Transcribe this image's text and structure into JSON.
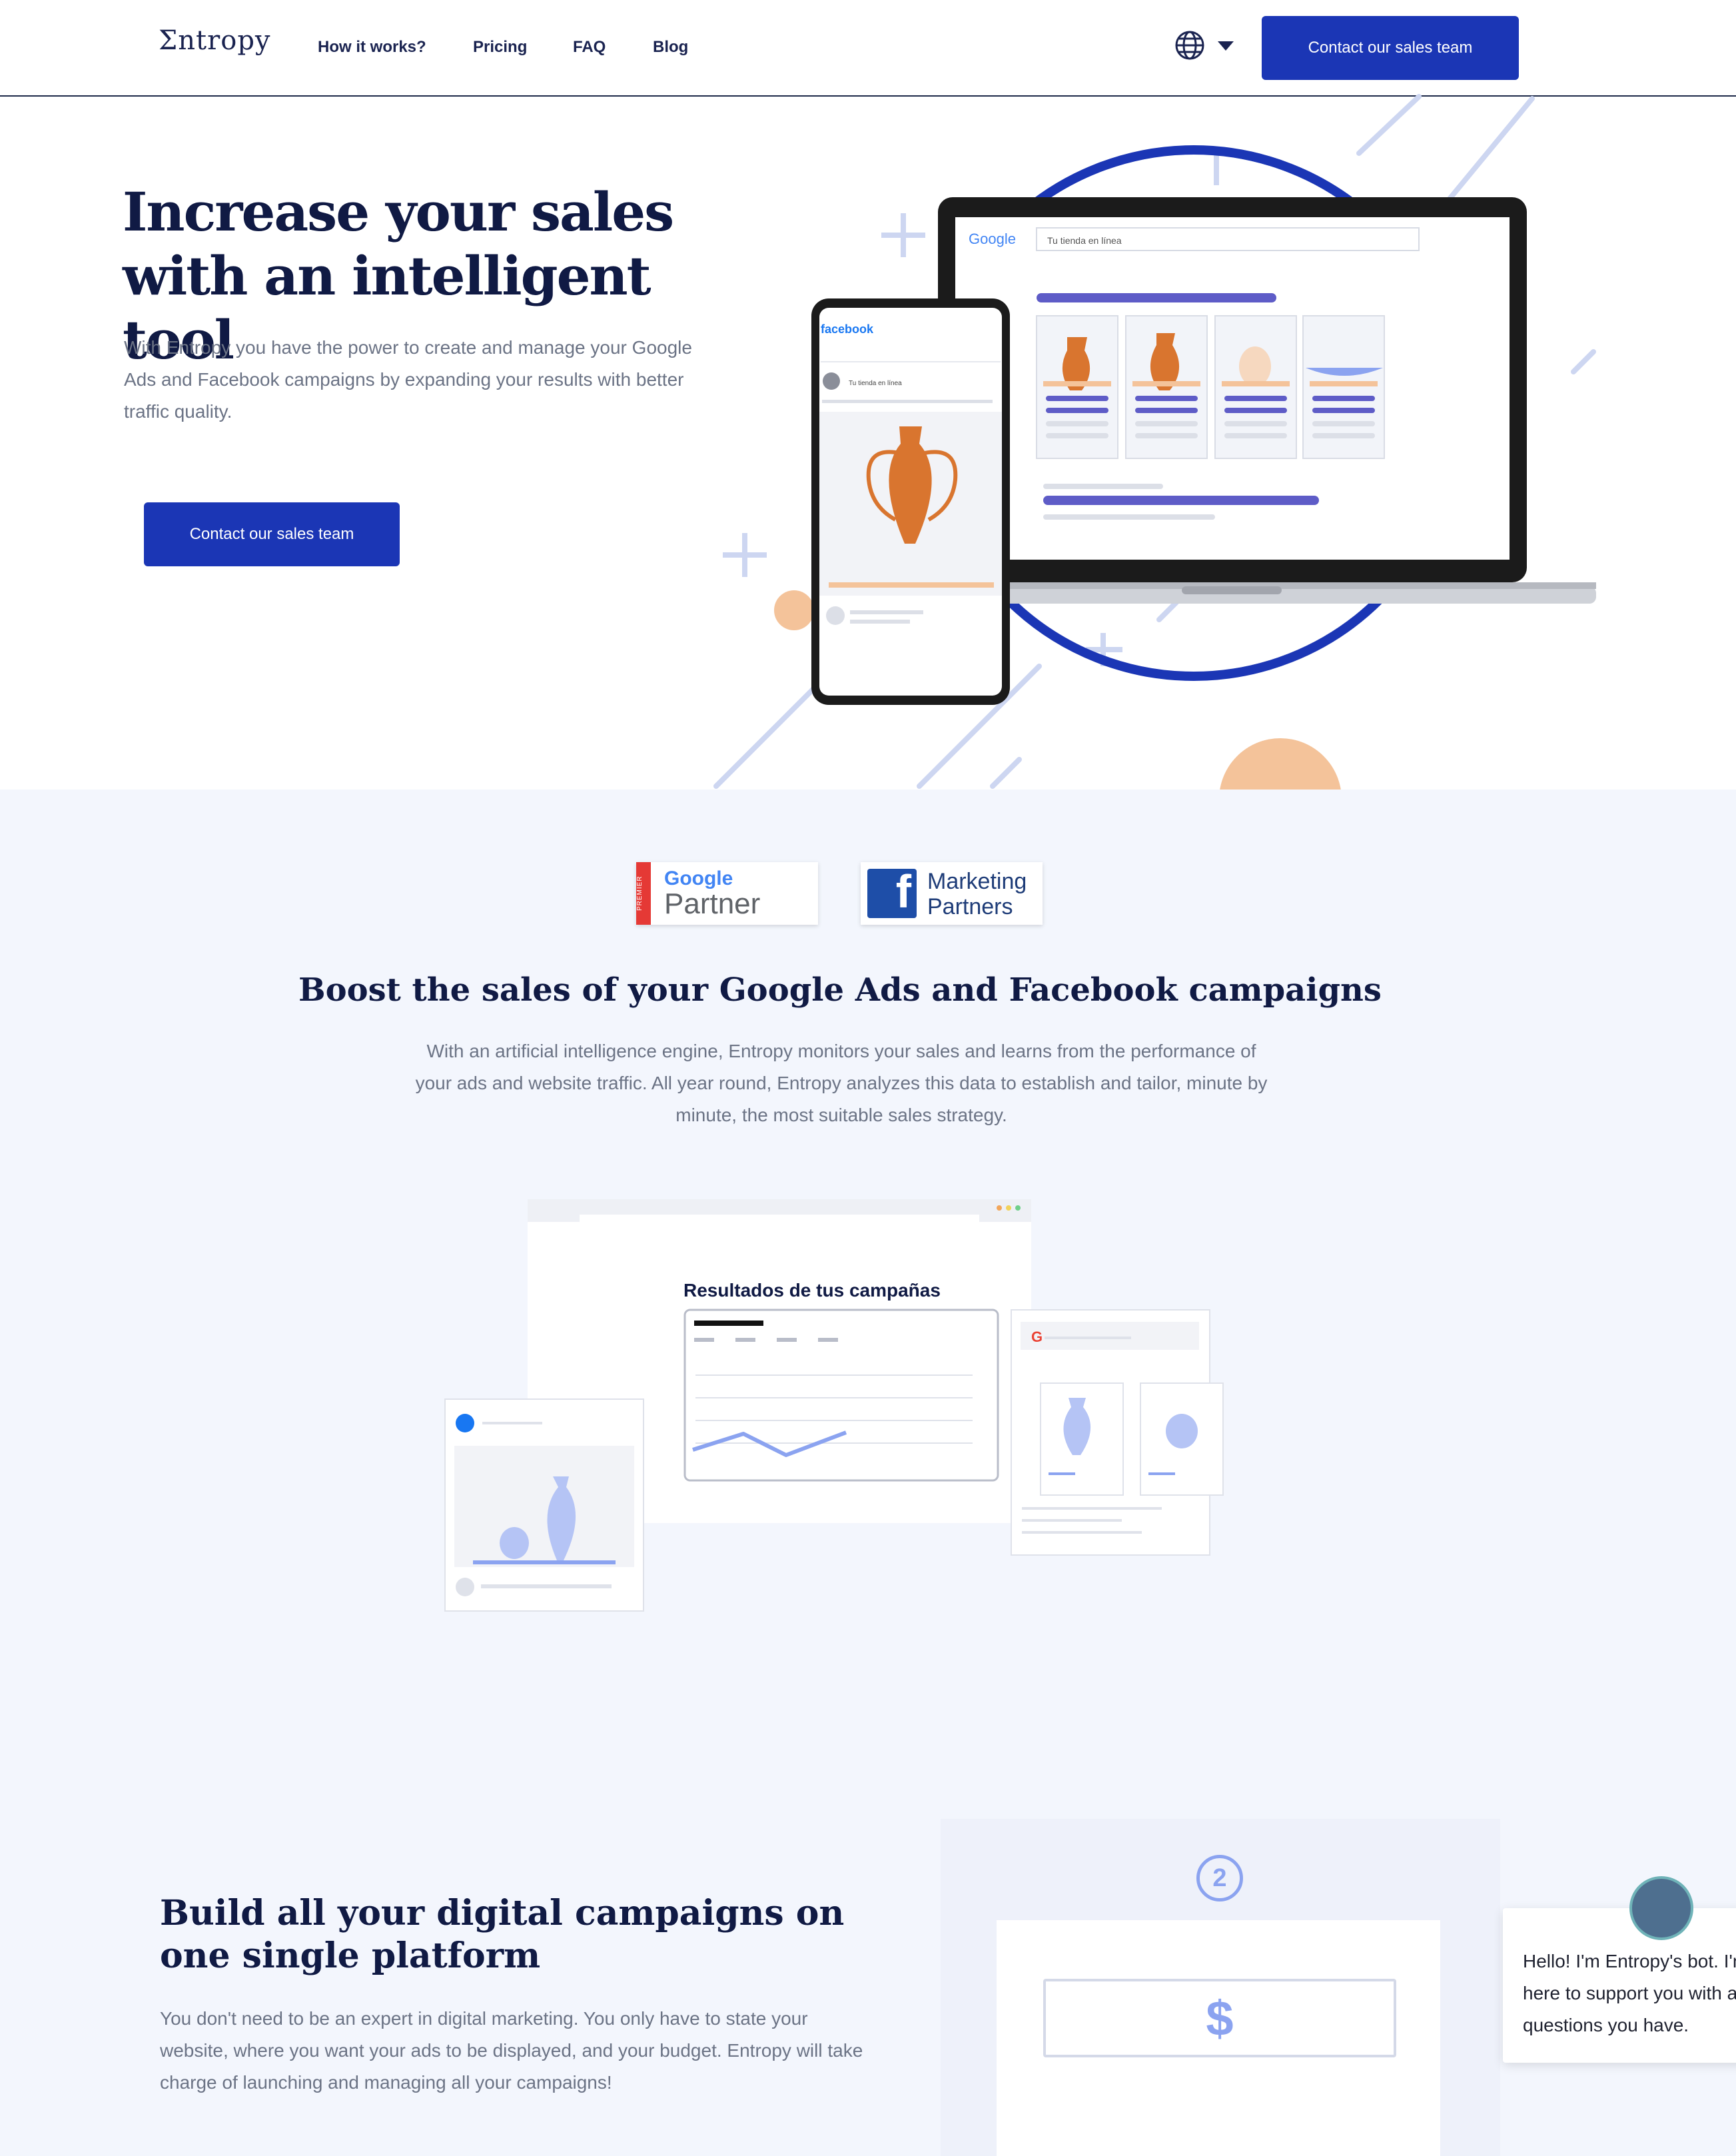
{
  "header": {
    "logo": "Σntropy",
    "nav": [
      "How it works?",
      "Pricing",
      "FAQ",
      "Blog"
    ],
    "contact_button": "Contact our sales team"
  },
  "hero": {
    "title": "Increase your sales with an intelligent tool",
    "description": "With Entropy you have the power to create and manage your Google Ads and Facebook campaigns by expanding your results with better traffic quality.",
    "cta": "Contact our sales team",
    "mockup": {
      "google_logo": "Google",
      "search_text": "Tu tienda en línea",
      "facebook_logo": "facebook",
      "fb_post_text": "Tu tienda en línea"
    }
  },
  "partners": {
    "google": {
      "premier": "PREMIER",
      "line1": "Google",
      "line2": "Partner"
    },
    "facebook": {
      "line1": "Marketing",
      "line2": "Partners",
      "mark": "f"
    }
  },
  "section2": {
    "title": "Boost the sales of your Google Ads and Facebook campaigns",
    "description": "With an artificial intelligence engine, Entropy monitors your sales and learns from the performance of your ads and website traffic. All year round, Entropy analyzes this data to establish and tailor, minute by minute, the most suitable sales strategy.",
    "dashboard_title": "Resultados de tus campañas"
  },
  "section3": {
    "title": "Build all your digital campaigns on one single platform",
    "description": "You don't need to be an expert in digital marketing. You only have to state your website, where you want your ads to be displayed, and your budget. Entropy will take charge of launching and managing all your campaigns!",
    "step_number": "2",
    "currency_symbol": "$"
  },
  "chat": {
    "message": "Hello! I'm Entropy's bot. I'm here to support you with any questions you have."
  },
  "colors": {
    "primary": "#1b36b5",
    "navy": "#101a44",
    "section_bg": "#f3f6fd",
    "accent_light": "#8ba3f0",
    "peach": "#f4c39a"
  }
}
